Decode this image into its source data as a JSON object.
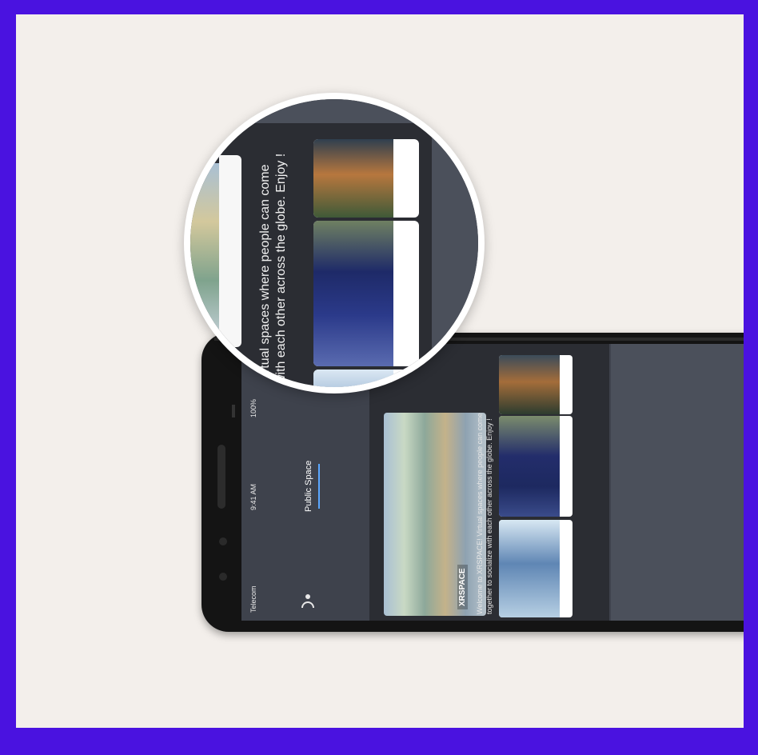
{
  "status_bar": {
    "carrier": "Telecom",
    "time": "9:41 AM",
    "battery": "100%"
  },
  "app": {
    "active_tab": "Public Space",
    "hero_label": "XRSPACE",
    "welcome_text_line1": "Welcome to XRSPACE! Virtual spaces where people can come",
    "welcome_text_line2": "together to socialize with each other across the globe. Enjoy !"
  },
  "magnifier": {
    "line1": "Virtual spaces where people can come",
    "line2": "with each other across the globe. Enjoy !"
  },
  "icons": [
    "profile-icon",
    "wifi-icon",
    "signal-icon",
    "battery-icon"
  ],
  "colors": {
    "border": "#4a12e0",
    "canvas": "#f3efeb",
    "app_bg": "#3e424c",
    "accent": "#5aa7ff"
  }
}
